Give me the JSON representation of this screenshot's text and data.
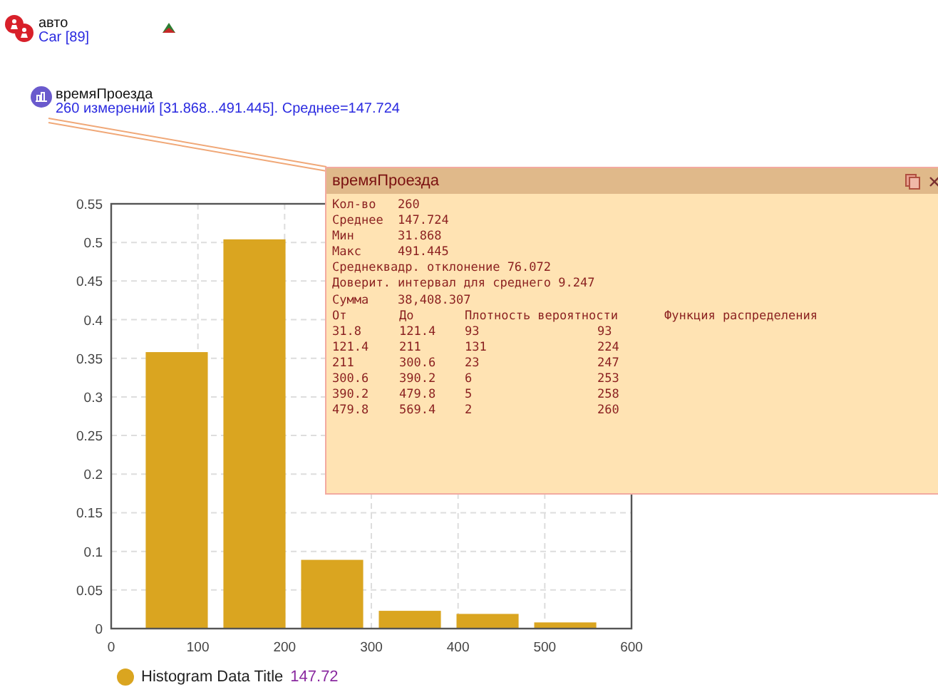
{
  "nodes": [
    {
      "kind": "people",
      "title": "авто",
      "subtitle": "Car [89]"
    },
    {
      "kind": "chart",
      "title": "времяПроезда",
      "subtitle": "260 измерений [31.868...491.445]. Среднее=147.724"
    }
  ],
  "popup": {
    "title": "времяПроезда",
    "stats": [
      {
        "label": "Кол-во",
        "value": "260"
      },
      {
        "label": "Среднее",
        "value": "147.724"
      },
      {
        "label": "Мин",
        "value": "31.868"
      },
      {
        "label": "Макс",
        "value": "491.445"
      },
      {
        "label": "Среднеквадр. отклонение",
        "value": "76.072"
      },
      {
        "label": "Доверит. интервал для среднего",
        "value": "9.247"
      },
      {
        "label": "Сумма",
        "value": "38,408.307"
      }
    ],
    "table": {
      "columns": [
        "От",
        "До",
        "Плотность вероятности",
        "Функция распределения"
      ],
      "rows": [
        [
          "31.8",
          "121.4",
          "93",
          "93"
        ],
        [
          "121.4",
          "211",
          "131",
          "224"
        ],
        [
          "211",
          "300.6",
          "23",
          "247"
        ],
        [
          "300.6",
          "390.2",
          "6",
          "253"
        ],
        [
          "390.2",
          "479.8",
          "5",
          "258"
        ],
        [
          "479.8",
          "569.4",
          "2",
          "260"
        ]
      ]
    }
  },
  "chart": {
    "chart_data": {
      "type": "bar",
      "x": [
        76.6,
        166.2,
        255.8,
        345.4,
        435,
        524.6
      ],
      "series": [
        {
          "name": "Histogram Data Title",
          "color": "#daa520",
          "values": [
            0.358,
            0.504,
            0.089,
            0.023,
            0.019,
            0.008
          ]
        }
      ],
      "grid": true,
      "xlim": [
        0,
        600
      ],
      "ylim": [
        0,
        0.55
      ],
      "xticks": [
        0,
        100,
        200,
        300,
        400,
        500,
        600
      ],
      "yticks": [
        0,
        0.05,
        0.1,
        0.15,
        0.2,
        0.25,
        0.3,
        0.35,
        0.4,
        0.45,
        0.5,
        0.55
      ]
    },
    "legend_value": "147.72"
  }
}
